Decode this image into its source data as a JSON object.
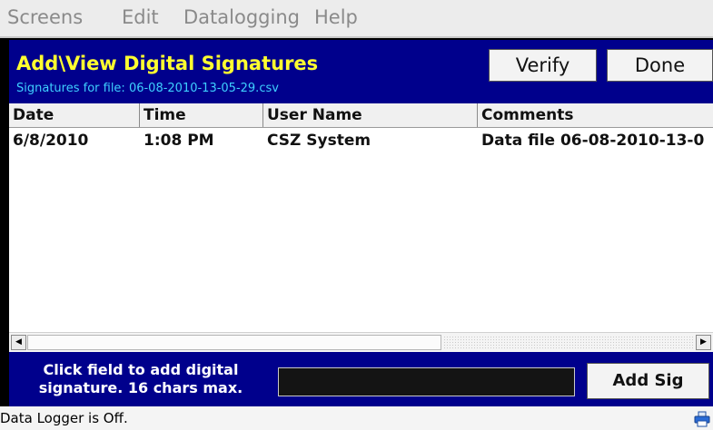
{
  "menu": {
    "items": [
      "Screens",
      "Edit",
      "Datalogging",
      "Help"
    ]
  },
  "dialog": {
    "title": "Add\\View Digital Signatures",
    "subtitle": "Signatures for file: 06-08-2010-13-05-29.csv",
    "verify_label": "Verify",
    "done_label": "Done"
  },
  "table": {
    "columns": [
      "Date",
      "Time",
      "User Name",
      "Comments"
    ],
    "rows": [
      [
        "6/8/2010",
        "1:08 PM",
        "CSZ System",
        "Data file 06-08-2010-13-0"
      ]
    ]
  },
  "signature": {
    "hint_line1": "Click field to add digital",
    "hint_line2": "signature. 16 chars max.",
    "input_value": "",
    "add_label": "Add Sig"
  },
  "status": {
    "text": "Data Logger is Off.",
    "icon": "printer-icon",
    "icon_color": "#2a6bd6"
  },
  "colors": {
    "panel_bg": "#00008c",
    "title": "#ffff30",
    "subtitle": "#3ed0ff"
  }
}
